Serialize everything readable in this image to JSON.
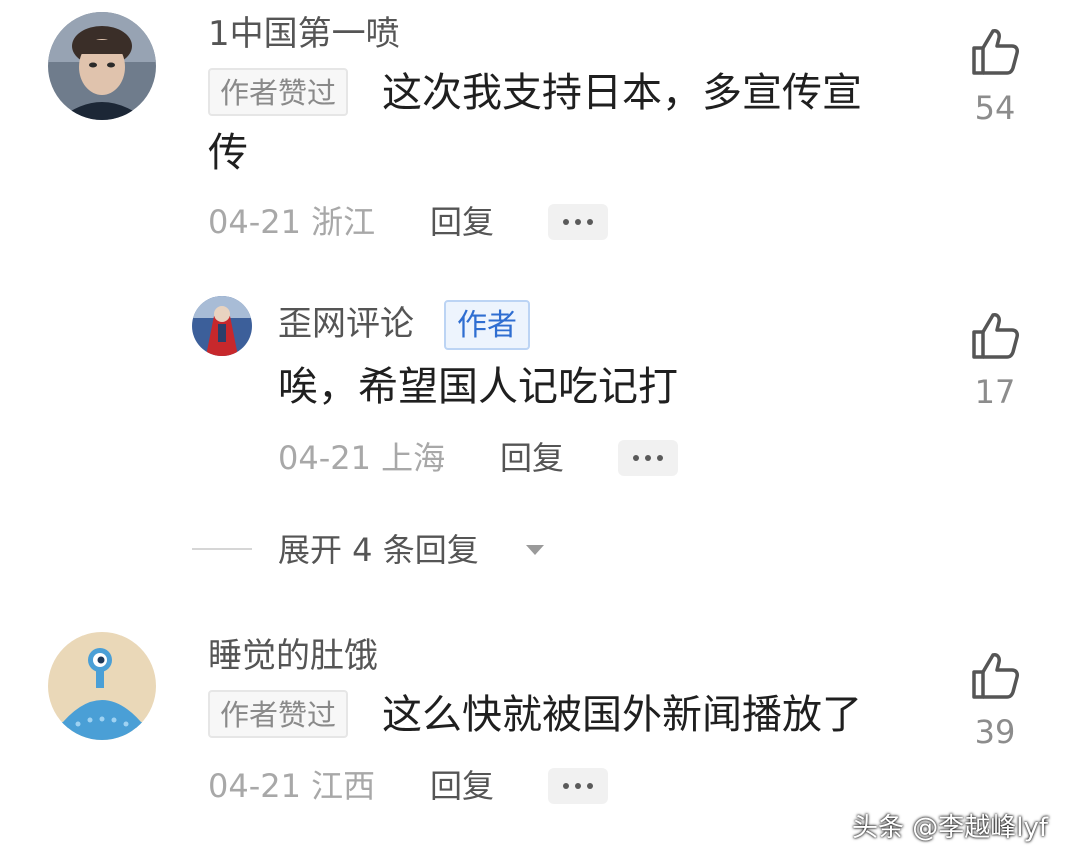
{
  "comments": [
    {
      "username": "1中国第一喷",
      "badge": "作者赞过",
      "text_line1": "这次我支持日本，多宣传宣",
      "text_line2": "传",
      "date": "04-21",
      "location": "浙江",
      "reply": "回复",
      "likes": "54"
    },
    {
      "username": "睡觉的肚饿",
      "badge": "作者赞过",
      "text_line1": "这么快就被国外新闻播放了",
      "date": "04-21",
      "location": "江西",
      "reply": "回复",
      "likes": "39"
    }
  ],
  "reply": {
    "username": "歪网评论",
    "badge": "作者",
    "text": "唉，希望国人记吃记打",
    "date": "04-21",
    "location": "上海",
    "reply": "回复",
    "likes": "17"
  },
  "expand_replies": "展开 4 条回复",
  "watermark": "头条 @李越峰lyf",
  "icons": {
    "like": "thumbs-up-icon",
    "more": "ellipsis-icon",
    "expand": "caret-down-icon"
  },
  "colors": {
    "author_badge_text": "#2f6ed1",
    "author_badge_bg": "#edf4fd",
    "meta_text": "#a8a8a8"
  }
}
